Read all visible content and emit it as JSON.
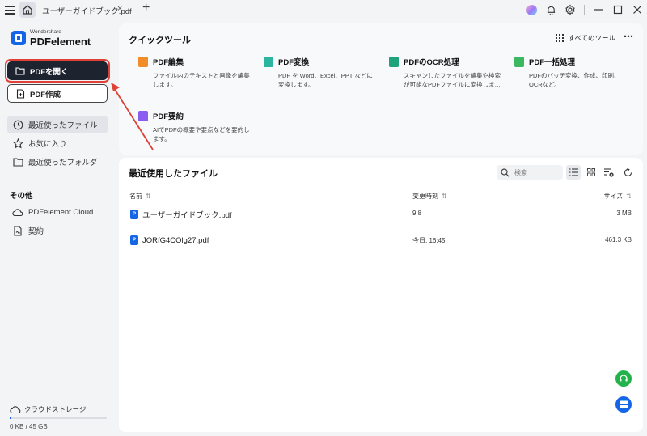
{
  "titlebar": {
    "tab_title": "ユーザーガイドブック.pdf",
    "tab_close": "×",
    "tab_add": "+",
    "icons": [
      "menu-icon",
      "home-icon",
      "avatar",
      "bell-icon",
      "gear-icon",
      "minimize-icon",
      "maximize-icon",
      "close-icon"
    ]
  },
  "sidebar": {
    "logo_small": "Wondershare",
    "logo_big": "PDFelement",
    "open_pdf": "PDFを開く",
    "create_pdf": "PDF作成",
    "nav": [
      {
        "label": "最近使ったファイル",
        "icon": "clock-icon",
        "active": true
      },
      {
        "label": "お気に入り",
        "icon": "star-icon",
        "active": false
      },
      {
        "label": "最近使ったフォルダ",
        "icon": "folder-icon",
        "active": false
      }
    ],
    "section_other": "その他",
    "other": [
      {
        "label": "PDFelement Cloud",
        "icon": "cloud-icon"
      },
      {
        "label": "契約",
        "icon": "contract-icon"
      }
    ],
    "cloud_storage": "クラウドストレージ",
    "storage_used": "0 KB / 45 GB",
    "storage_fraction": 0.0
  },
  "quick_tools": {
    "title": "クイックツール",
    "all_tools": "すべてのツール",
    "more": "⋯",
    "tools": [
      {
        "name": "PDF編集",
        "desc1": "ファイル内のテキストと画像を編集",
        "desc2": "します。",
        "color": "#f28c28"
      },
      {
        "name": "PDF変換",
        "desc1": "PDF を Word、Excel、PPT などに",
        "desc2": "変換します。",
        "color": "#2bb5a0"
      },
      {
        "name": "PDFのOCR処理",
        "desc1": "スキャンしたファイルを編集や検索",
        "desc2": "が可能なPDFファイルに変換しま…",
        "color": "#1fa37a"
      },
      {
        "name": "PDF一括処理",
        "desc1": "PDFのバッチ変換、作成、印刷、",
        "desc2": "OCRなど。",
        "color": "#3cb861"
      },
      {
        "name": "PDF要約",
        "desc1": "AIでPDFの概要や要点などを要約し",
        "desc2": "ます。",
        "color": "#8a5cf0"
      }
    ]
  },
  "recent_files": {
    "title": "最近使用したファイル",
    "search_placeholder": "検索",
    "col_name": "名前",
    "col_modified": "変更時刻",
    "col_size": "サイズ",
    "sort_glyph": "⇅",
    "rows": [
      {
        "name": "ユーザーガイドブック.pdf",
        "modified": "9 8",
        "size": "3 MB"
      },
      {
        "name": "JORfG4COlg27.pdf",
        "modified": "今日, 16:45",
        "size": "461.3 KB"
      }
    ],
    "file_badge": "P"
  },
  "colors": {
    "accent": "#1466e6",
    "annotation": "#e04035",
    "open_button_bg": "#1e2330",
    "support_fab": "#22b34a",
    "layout_fab": "#1466e6"
  }
}
